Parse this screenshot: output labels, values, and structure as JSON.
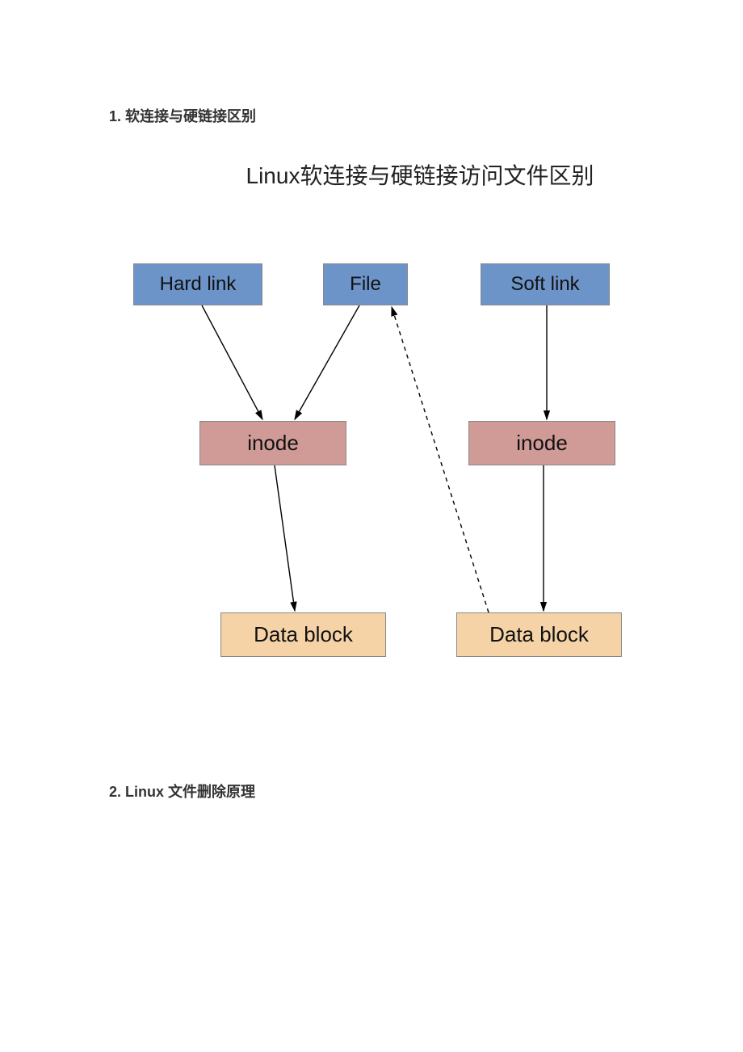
{
  "headings": {
    "h1": "1. 软连接与硬链接区别",
    "h2": "2. Linux 文件删除原理"
  },
  "diagram": {
    "title": "Linux软连接与硬链接访问文件区别",
    "boxes": {
      "hardlink": "Hard link",
      "file": "File",
      "softlink": "Soft link",
      "inode1": "inode",
      "inode2": "inode",
      "data1": "Data block",
      "data2": "Data block"
    }
  },
  "chart_data": {
    "type": "diagram",
    "title": "Linux软连接与硬链接访问文件区别",
    "nodes": [
      {
        "id": "hardlink",
        "label": "Hard link",
        "row": 0,
        "color": "blue"
      },
      {
        "id": "file",
        "label": "File",
        "row": 0,
        "color": "blue"
      },
      {
        "id": "softlink",
        "label": "Soft link",
        "row": 0,
        "color": "blue"
      },
      {
        "id": "inode1",
        "label": "inode",
        "row": 1,
        "color": "rose"
      },
      {
        "id": "inode2",
        "label": "inode",
        "row": 1,
        "color": "rose"
      },
      {
        "id": "data1",
        "label": "Data block",
        "row": 2,
        "color": "tan"
      },
      {
        "id": "data2",
        "label": "Data block",
        "row": 2,
        "color": "tan"
      }
    ],
    "edges": [
      {
        "from": "hardlink",
        "to": "inode1",
        "style": "solid"
      },
      {
        "from": "file",
        "to": "inode1",
        "style": "solid"
      },
      {
        "from": "softlink",
        "to": "inode2",
        "style": "solid"
      },
      {
        "from": "inode1",
        "to": "data1",
        "style": "solid"
      },
      {
        "from": "inode2",
        "to": "data2",
        "style": "solid"
      },
      {
        "from": "data2",
        "to": "file",
        "style": "dashed"
      }
    ]
  }
}
